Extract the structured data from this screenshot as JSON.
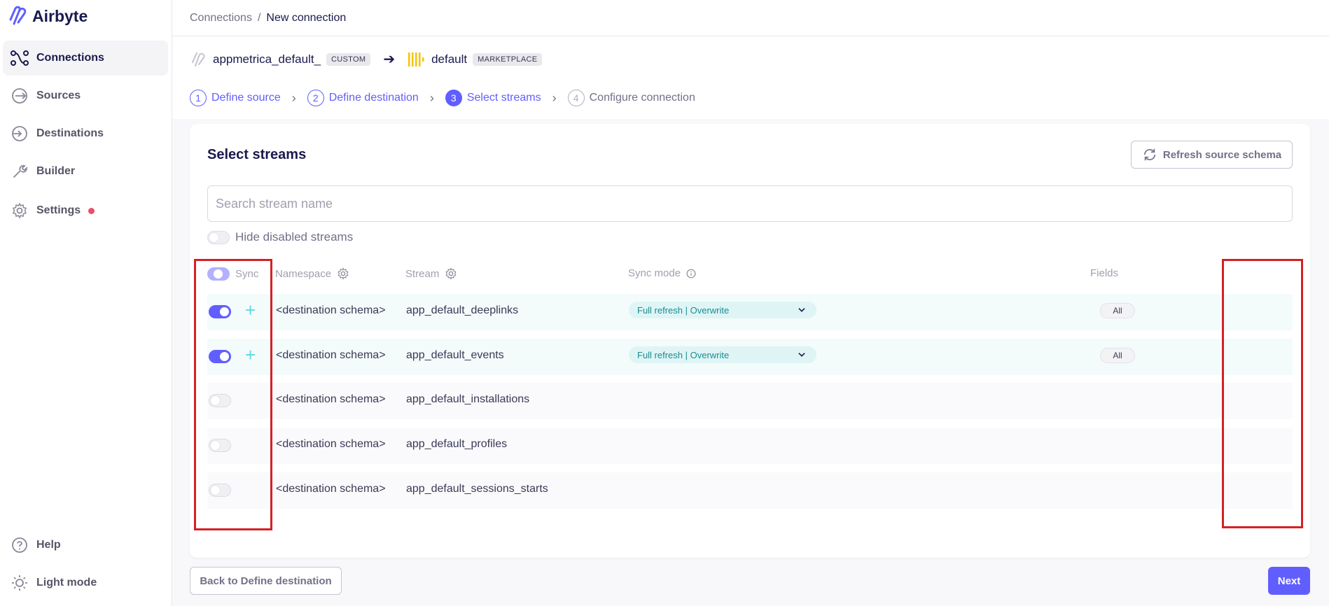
{
  "app": {
    "name": "Airbyte"
  },
  "sidebar": {
    "items": [
      {
        "label": "Connections",
        "icon": "connections-icon"
      },
      {
        "label": "Sources",
        "icon": "sources-icon"
      },
      {
        "label": "Destinations",
        "icon": "destinations-icon"
      },
      {
        "label": "Builder",
        "icon": "builder-icon"
      },
      {
        "label": "Settings",
        "icon": "gear-icon"
      }
    ],
    "bottom": [
      {
        "label": "Help",
        "icon": "help-icon"
      },
      {
        "label": "Light mode",
        "icon": "sun-icon"
      }
    ]
  },
  "breadcrumb": {
    "parent": "Connections",
    "separator": "/",
    "current": "New connection"
  },
  "connection": {
    "source_name": "appmetrica_default_",
    "source_tag": "CUSTOM",
    "destination_name": "default",
    "destination_tag": "MARKETPLACE"
  },
  "steps": [
    {
      "num": "1",
      "label": "Define source"
    },
    {
      "num": "2",
      "label": "Define destination"
    },
    {
      "num": "3",
      "label": "Select streams"
    },
    {
      "num": "4",
      "label": "Configure connection"
    }
  ],
  "main": {
    "title": "Select streams",
    "refresh_label": "Refresh source schema",
    "search_placeholder": "Search stream name",
    "hide_disabled_label": "Hide disabled streams"
  },
  "table": {
    "headers": {
      "sync": "Sync",
      "namespace": "Namespace",
      "stream": "Stream",
      "sync_mode": "Sync mode",
      "fields": "Fields"
    },
    "rows": [
      {
        "enabled": true,
        "namespace": "<destination schema>",
        "stream": "app_default_deeplinks",
        "sync_mode": "Full refresh | Overwrite",
        "fields": "All"
      },
      {
        "enabled": true,
        "namespace": "<destination schema>",
        "stream": "app_default_events",
        "sync_mode": "Full refresh | Overwrite",
        "fields": "All"
      },
      {
        "enabled": false,
        "namespace": "<destination schema>",
        "stream": "app_default_installations"
      },
      {
        "enabled": false,
        "namespace": "<destination schema>",
        "stream": "app_default_profiles"
      },
      {
        "enabled": false,
        "namespace": "<destination schema>",
        "stream": "app_default_sessions_starts"
      }
    ]
  },
  "footer": {
    "back_label": "Back to Define destination",
    "next_label": "Next"
  },
  "colors": {
    "accent": "#615eff",
    "highlight": "#d42025",
    "sync_mode_bg": "#dff5f5",
    "notif_dot": "#e8506b"
  }
}
